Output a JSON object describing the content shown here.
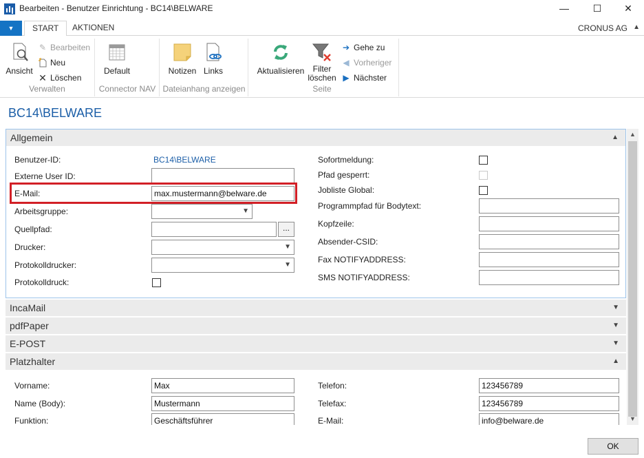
{
  "window": {
    "title": "Bearbeiten - Benutzer Einrichtung - BC14\\BELWARE",
    "minimize": "—",
    "maximize": "☐",
    "close": "✕"
  },
  "ribbon": {
    "app_menu_glyph": "▼",
    "tabs": [
      "START",
      "AKTIONEN"
    ],
    "company": "CRONUS AG",
    "groups": {
      "verwalten": {
        "label": "Verwalten",
        "ansicht": "Ansicht",
        "bearbeiten": "Bearbeiten",
        "neu": "Neu",
        "loeschen": "Löschen"
      },
      "connector": {
        "label": "Connector NAV",
        "default": "Default"
      },
      "dateianhang": {
        "label": "Dateianhang anzeigen",
        "notizen": "Notizen",
        "links": "Links"
      },
      "seite": {
        "label": "Seite",
        "aktualisieren": "Aktualisieren",
        "filter_line1": "Filter",
        "filter_line2": "löschen",
        "gehe_zu": "Gehe zu",
        "vorheriger": "Vorheriger",
        "naechster": "Nächster"
      }
    }
  },
  "page_title": "BC14\\BELWARE",
  "sections": {
    "allgemein": {
      "title": "Allgemein",
      "left": {
        "benutzer_id_label": "Benutzer-ID:",
        "benutzer_id_value": "BC14\\BELWARE",
        "externe_user_id_label": "Externe User ID:",
        "externe_user_id_value": "",
        "email_label": "E-Mail:",
        "email_value": "max.mustermann@belware.de",
        "arbeitsgruppe_label": "Arbeitsgruppe:",
        "arbeitsgruppe_value": "",
        "quellpfad_label": "Quellpfad:",
        "quellpfad_value": "",
        "quellpfad_button": "...",
        "drucker_label": "Drucker:",
        "drucker_value": "",
        "protokolldrucker_label": "Protokolldrucker:",
        "protokolldrucker_value": "",
        "protokolldruck_label": "Protokolldruck:",
        "protokolldruck_checked": false
      },
      "right": {
        "sofortmeldung_label": "Sofortmeldung:",
        "sofortmeldung_checked": false,
        "pfad_gesperrt_label": "Pfad gesperrt:",
        "pfad_gesperrt_checked": false,
        "jobliste_global_label": "Jobliste Global:",
        "jobliste_global_checked": false,
        "programmpfad_label": "Programmpfad für Bodytext:",
        "programmpfad_value": "",
        "kopfzeile_label": "Kopfzeile:",
        "kopfzeile_value": "",
        "absender_csid_label": "Absender-CSID:",
        "absender_csid_value": "",
        "fax_label": "Fax NOTIFYADDRESS:",
        "fax_value": "",
        "sms_label": "SMS NOTIFYADDRESS:",
        "sms_value": ""
      }
    },
    "incamail": {
      "title": "IncaMail"
    },
    "pdfpaper": {
      "title": "pdfPaper"
    },
    "epost": {
      "title": "E-POST"
    },
    "platzhalter": {
      "title": "Platzhalter",
      "vorname_label": "Vorname:",
      "vorname_value": "Max",
      "name_body_label": "Name (Body):",
      "name_body_value": "Mustermann",
      "funktion_label": "Funktion:",
      "funktion_value": "Geschäftsführer",
      "telefon_label": "Telefon:",
      "telefon_value": "123456789",
      "telefax_label": "Telefax:",
      "telefax_value": "123456789",
      "email_label": "E-Mail:",
      "email_value": "info@belware.de"
    }
  },
  "footer": {
    "ok_label": "OK"
  },
  "colors": {
    "accent": "#1473c4",
    "title_blue": "#1b5ea7",
    "highlight_red": "#d21f26",
    "section_header": "#ebebeb"
  }
}
